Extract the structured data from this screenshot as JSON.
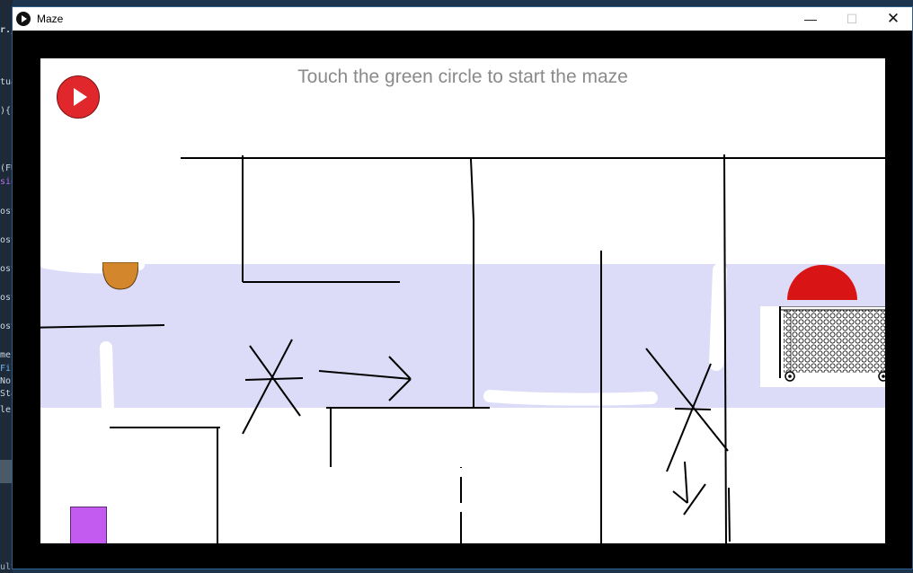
{
  "window": {
    "title": "Maze",
    "minimize_glyph": "—",
    "maximize_glyph": "☐",
    "close_glyph": "✕"
  },
  "game": {
    "prompt": "Touch the green circle to start the maze",
    "colors": {
      "play_button": "#e0272b",
      "ball": "#d4862c",
      "finish": "#d81414",
      "player_block": "#c45bf0",
      "highlight_band": "#dcdcf8"
    }
  },
  "background_editor": {
    "fragments": [
      "r.j",
      "tua",
      "){",
      "(FU",
      "sio",
      "ost",
      "ost",
      "ost",
      "ost",
      "ost",
      "mer",
      "Fil",
      "No:",
      "Sta",
      "le",
      "ults"
    ]
  }
}
